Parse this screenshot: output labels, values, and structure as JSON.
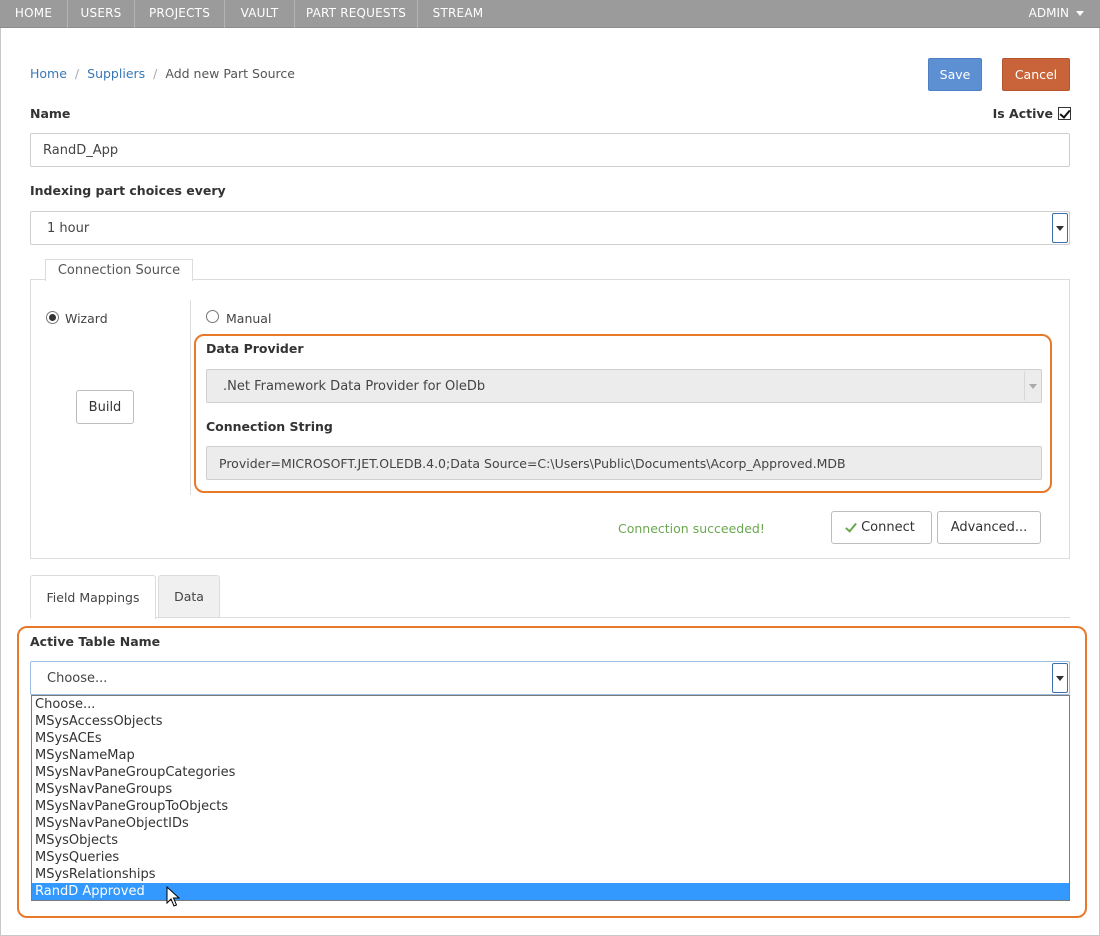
{
  "nav": {
    "items": [
      "HOME",
      "USERS",
      "PROJECTS",
      "VAULT",
      "PART REQUESTS",
      "STREAM"
    ],
    "user_menu": "ADMIN"
  },
  "breadcrumb": {
    "home": "Home",
    "suppliers": "Suppliers",
    "current": "Add new Part Source"
  },
  "actions": {
    "save": "Save",
    "cancel": "Cancel"
  },
  "form": {
    "name_label": "Name",
    "name_value": "RandD_App",
    "is_active_label": "Is Active",
    "is_active": true,
    "indexing_label": "Indexing part choices every",
    "indexing_value": "1 hour"
  },
  "connection": {
    "legend": "Connection Source",
    "wizard_label": "Wizard",
    "manual_label": "Manual",
    "build_label": "Build",
    "data_provider_label": "Data Provider",
    "data_provider_value": ".Net Framework Data Provider for OleDb",
    "connection_string_label": "Connection String",
    "connection_string_value": "Provider=MICROSOFT.JET.OLEDB.4.0;Data Source=C:\\Users\\Public\\Documents\\Acorp_Approved.MDB",
    "status": "Connection succeeded!",
    "connect_label": "Connect",
    "advanced_label": "Advanced..."
  },
  "tabs": {
    "field_mappings": "Field Mappings",
    "data": "Data"
  },
  "table": {
    "label": "Active Table Name",
    "selected_display": "Choose...",
    "options": [
      "Choose...",
      "MSysAccessObjects",
      "MSysACEs",
      "MSysNameMap",
      "MSysNavPaneGroupCategories",
      "MSysNavPaneGroups",
      "MSysNavPaneGroupToObjects",
      "MSysNavPaneObjectIDs",
      "MSysObjects",
      "MSysQueries",
      "MSysRelationships",
      "RandD Approved"
    ],
    "highlighted_option": "RandD Approved"
  },
  "colors": {
    "nav_bg": "#9b9b9b",
    "save": "#5d8fd3",
    "cancel": "#c9643a",
    "highlight": "#e8782a",
    "success": "#6aa84f",
    "selection": "#3399ff"
  }
}
